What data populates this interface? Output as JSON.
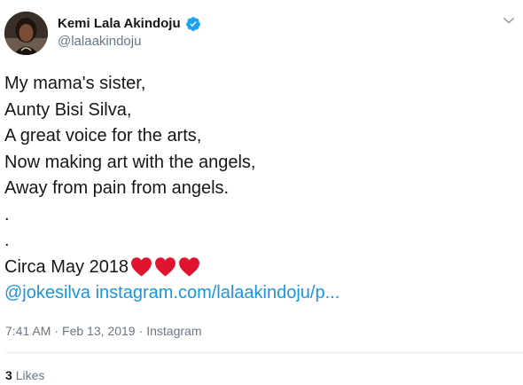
{
  "author": {
    "display_name": "Kemi Lala Akindoju",
    "handle": "@lalaakindoju",
    "verified": true,
    "verified_icon": "verified-badge-icon",
    "verified_color": "#1da1f2",
    "avatar_icon": "profile-photo"
  },
  "menu": {
    "icon": "chevron-down-icon"
  },
  "tweet": {
    "lines": [
      "My mama's sister,",
      "Aunty Bisi Silva,",
      "A great voice for the arts,",
      "Now making art with the angels,",
      "Away from pain from angels.",
      ".",
      ".",
      "Circa May 2018"
    ],
    "hearts": [
      "heart-icon",
      "heart-icon",
      "heart-icon"
    ],
    "heart_color": "#e0142e",
    "mention": "@jokesilva",
    "link": "instagram.com/lalaakindoju/p..."
  },
  "meta": {
    "time": "7:41 AM",
    "separator": "·",
    "date": "Feb 13, 2019",
    "source": "Instagram"
  },
  "stats": {
    "likes_count": "3",
    "likes_label": "Likes"
  },
  "colors": {
    "text": "#14171a",
    "secondary": "#657786",
    "link": "#1b95e0",
    "divider": "#e6ecf0"
  }
}
